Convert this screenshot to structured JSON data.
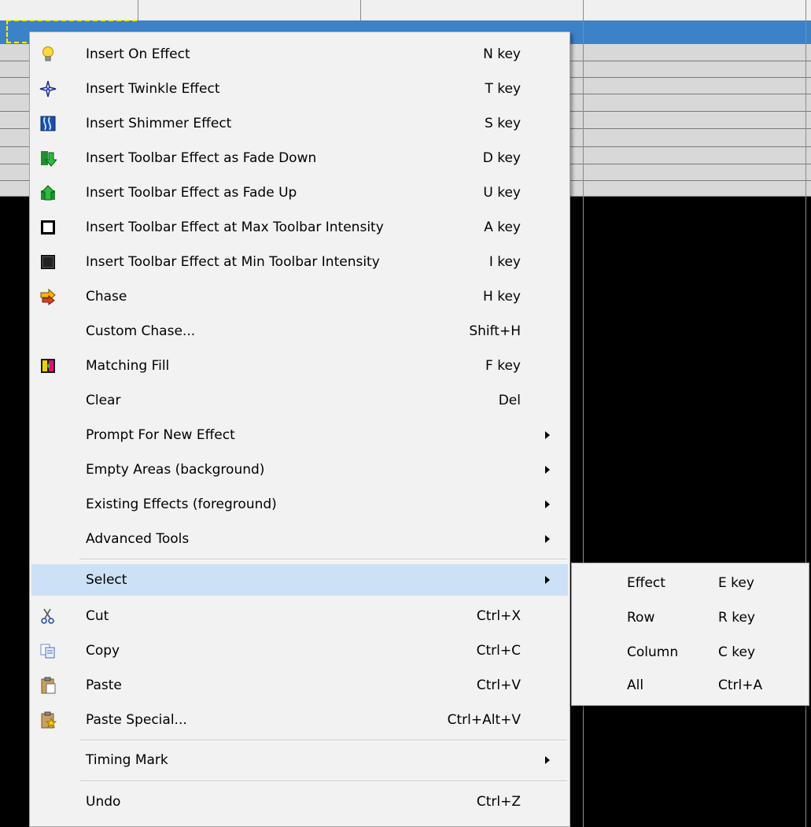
{
  "menu": {
    "items": [
      {
        "label": "Insert On Effect",
        "shortcut": "N key",
        "icon": "lightbulb-icon"
      },
      {
        "label": "Insert Twinkle Effect",
        "shortcut": "T key",
        "icon": "twinkle-icon"
      },
      {
        "label": "Insert Shimmer Effect",
        "shortcut": "S key",
        "icon": "shimmer-icon"
      },
      {
        "label": "Insert Toolbar Effect as Fade Down",
        "shortcut": "D key",
        "icon": "fade-down-icon"
      },
      {
        "label": "Insert Toolbar Effect as Fade Up",
        "shortcut": "U key",
        "icon": "fade-up-icon"
      },
      {
        "label": "Insert Toolbar Effect at Max Toolbar Intensity",
        "shortcut": "A key",
        "icon": "max-intensity-icon"
      },
      {
        "label": "Insert Toolbar Effect at Min Toolbar Intensity",
        "shortcut": "I key",
        "icon": "min-intensity-icon"
      },
      {
        "label": "Chase",
        "shortcut": "H key",
        "icon": "chase-icon"
      },
      {
        "label": "Custom Chase...",
        "shortcut": "Shift+H"
      },
      {
        "label": "Matching Fill",
        "shortcut": "F key",
        "icon": "matching-fill-icon"
      },
      {
        "label": "Clear",
        "shortcut": "Del"
      },
      {
        "label": "Prompt For New Effect",
        "submenu": true
      },
      {
        "label": "Empty Areas (background)",
        "submenu": true
      },
      {
        "label": "Existing Effects (foreground)",
        "submenu": true
      },
      {
        "label": "Advanced Tools",
        "submenu": true
      },
      {
        "label": "Select",
        "submenu": true,
        "highlighted": true
      },
      {
        "label": "Cut",
        "shortcut": "Ctrl+X",
        "icon": "scissors-icon"
      },
      {
        "label": "Copy",
        "shortcut": "Ctrl+C",
        "icon": "copy-icon"
      },
      {
        "label": "Paste",
        "shortcut": "Ctrl+V",
        "icon": "clipboard-icon"
      },
      {
        "label": "Paste Special...",
        "shortcut": "Ctrl+Alt+V",
        "icon": "paste-special-icon"
      },
      {
        "label": "Timing Mark",
        "submenu": true
      },
      {
        "label": "Undo",
        "shortcut": "Ctrl+Z"
      }
    ]
  },
  "select_submenu": {
    "items": [
      {
        "label": "Effect",
        "shortcut": "E key"
      },
      {
        "label": "Row",
        "shortcut": "R key"
      },
      {
        "label": "Column",
        "shortcut": "C key"
      },
      {
        "label": "All",
        "shortcut": "Ctrl+A"
      }
    ]
  },
  "colors": {
    "selected_row": "#3c82c8",
    "menu_background": "#f2f2f2",
    "highlight": "#cce1f6",
    "marquee": "#ffef00"
  }
}
